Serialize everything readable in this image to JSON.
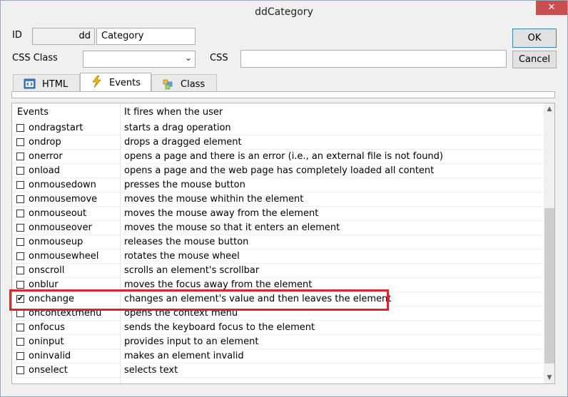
{
  "window": {
    "title": "ddCategory",
    "close_glyph": "✕"
  },
  "form": {
    "id_label": "ID",
    "id_prefix": "dd",
    "id_value": "Category",
    "css_class_label": "CSS Class",
    "css_class_value": "",
    "css_label": "CSS",
    "css_value": ""
  },
  "buttons": {
    "ok": "OK",
    "cancel": "Cancel"
  },
  "tabs": [
    {
      "label": "HTML",
      "icon": "html-code-icon"
    },
    {
      "label": "Events",
      "icon": "lightning-icon",
      "active": true
    },
    {
      "label": "Class",
      "icon": "class-puzzle-icon"
    }
  ],
  "table": {
    "headers": [
      "Events",
      "It fires when the user"
    ],
    "rows": [
      {
        "event": "ondragstart",
        "desc": "starts a drag operation",
        "checked": false
      },
      {
        "event": "ondrop",
        "desc": "drops a dragged element",
        "checked": false
      },
      {
        "event": "onerror",
        "desc": "opens a page and there is an error (i.e., an external file is not found)",
        "checked": false
      },
      {
        "event": "onload",
        "desc": "opens a page and  the web page has completely loaded all content",
        "checked": false
      },
      {
        "event": "onmousedown",
        "desc": "presses the mouse button",
        "checked": false
      },
      {
        "event": "onmousemove",
        "desc": "moves the mouse whithin the element",
        "checked": false
      },
      {
        "event": "onmouseout",
        "desc": "moves the mouse away from the element",
        "checked": false
      },
      {
        "event": "onmouseover",
        "desc": "moves the mouse so that it enters an element",
        "checked": false
      },
      {
        "event": "onmouseup",
        "desc": "releases the mouse button",
        "checked": false
      },
      {
        "event": "onmousewheel",
        "desc": "rotates the mouse wheel",
        "checked": false
      },
      {
        "event": "onscroll",
        "desc": "scrolls an element's scrollbar",
        "checked": false
      },
      {
        "event": "onblur",
        "desc": "moves the focus away from the element",
        "checked": false
      },
      {
        "event": "onchange",
        "desc": "changes an element's value and then leaves the element",
        "checked": true
      },
      {
        "event": "oncontextmenu",
        "desc": "opens the context menu",
        "checked": false
      },
      {
        "event": "onfocus",
        "desc": "sends the keyboard focus to the element",
        "checked": false
      },
      {
        "event": "oninput",
        "desc": "provides input to an element",
        "checked": false
      },
      {
        "event": "oninvalid",
        "desc": "makes an element invalid",
        "checked": false
      },
      {
        "event": "onselect",
        "desc": "selects text",
        "checked": false
      }
    ]
  },
  "colors": {
    "highlight": "#e0242a",
    "close": "#c7504e"
  }
}
